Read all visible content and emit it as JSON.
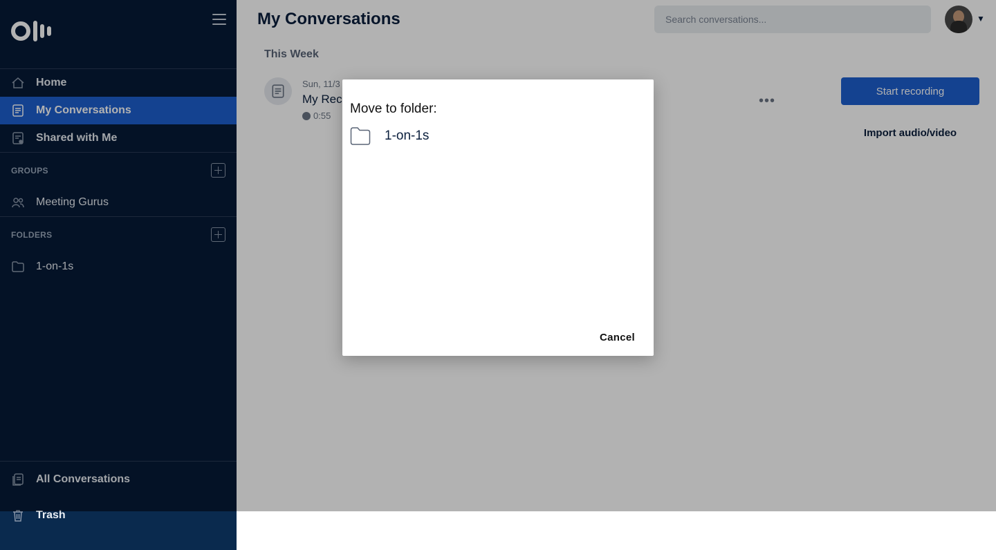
{
  "sidebar": {
    "nav": [
      {
        "label": "Home",
        "icon": "home-icon"
      },
      {
        "label": "My Conversations",
        "icon": "document-icon"
      },
      {
        "label": "Shared with Me",
        "icon": "shared-doc-icon"
      }
    ],
    "groups_heading": "GROUPS",
    "groups": [
      {
        "label": "Meeting Gurus",
        "icon": "people-icon"
      }
    ],
    "folders_heading": "FOLDERS",
    "folders": [
      {
        "label": "1-on-1s",
        "icon": "folder-icon"
      }
    ],
    "bottom": [
      {
        "label": "All Conversations",
        "icon": "stacked-docs-icon"
      },
      {
        "label": "Trash",
        "icon": "trash-icon"
      }
    ]
  },
  "header": {
    "title": "My Conversations",
    "search_placeholder": "Search conversations..."
  },
  "main": {
    "week_label": "This Week",
    "conversation": {
      "date": "Sun, 11/3",
      "title": "My Rec",
      "duration": "0:55"
    },
    "start_recording": "Start recording",
    "import": "Import audio/video"
  },
  "dialog": {
    "title": "Move to folder:",
    "folders": [
      {
        "label": "1-on-1s"
      }
    ],
    "cancel": "Cancel"
  },
  "colors": {
    "sidebar_bg": "#061a37",
    "accent": "#1e5fcf"
  }
}
